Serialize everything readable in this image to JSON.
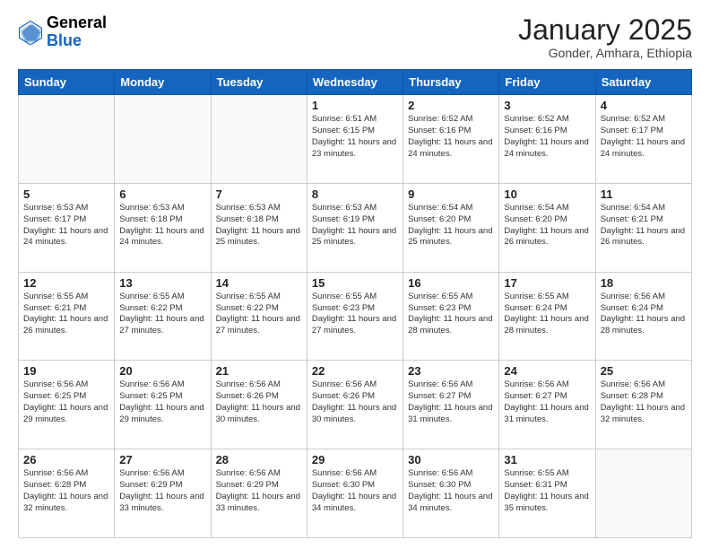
{
  "header": {
    "logo_general": "General",
    "logo_blue": "Blue",
    "month_title": "January 2025",
    "subtitle": "Gonder, Amhara, Ethiopia"
  },
  "weekdays": [
    "Sunday",
    "Monday",
    "Tuesday",
    "Wednesday",
    "Thursday",
    "Friday",
    "Saturday"
  ],
  "weeks": [
    [
      {
        "day": "",
        "info": ""
      },
      {
        "day": "",
        "info": ""
      },
      {
        "day": "",
        "info": ""
      },
      {
        "day": "1",
        "info": "Sunrise: 6:51 AM\nSunset: 6:15 PM\nDaylight: 11 hours and 23 minutes."
      },
      {
        "day": "2",
        "info": "Sunrise: 6:52 AM\nSunset: 6:16 PM\nDaylight: 11 hours and 24 minutes."
      },
      {
        "day": "3",
        "info": "Sunrise: 6:52 AM\nSunset: 6:16 PM\nDaylight: 11 hours and 24 minutes."
      },
      {
        "day": "4",
        "info": "Sunrise: 6:52 AM\nSunset: 6:17 PM\nDaylight: 11 hours and 24 minutes."
      }
    ],
    [
      {
        "day": "5",
        "info": "Sunrise: 6:53 AM\nSunset: 6:17 PM\nDaylight: 11 hours and 24 minutes."
      },
      {
        "day": "6",
        "info": "Sunrise: 6:53 AM\nSunset: 6:18 PM\nDaylight: 11 hours and 24 minutes."
      },
      {
        "day": "7",
        "info": "Sunrise: 6:53 AM\nSunset: 6:18 PM\nDaylight: 11 hours and 25 minutes."
      },
      {
        "day": "8",
        "info": "Sunrise: 6:53 AM\nSunset: 6:19 PM\nDaylight: 11 hours and 25 minutes."
      },
      {
        "day": "9",
        "info": "Sunrise: 6:54 AM\nSunset: 6:20 PM\nDaylight: 11 hours and 25 minutes."
      },
      {
        "day": "10",
        "info": "Sunrise: 6:54 AM\nSunset: 6:20 PM\nDaylight: 11 hours and 26 minutes."
      },
      {
        "day": "11",
        "info": "Sunrise: 6:54 AM\nSunset: 6:21 PM\nDaylight: 11 hours and 26 minutes."
      }
    ],
    [
      {
        "day": "12",
        "info": "Sunrise: 6:55 AM\nSunset: 6:21 PM\nDaylight: 11 hours and 26 minutes."
      },
      {
        "day": "13",
        "info": "Sunrise: 6:55 AM\nSunset: 6:22 PM\nDaylight: 11 hours and 27 minutes."
      },
      {
        "day": "14",
        "info": "Sunrise: 6:55 AM\nSunset: 6:22 PM\nDaylight: 11 hours and 27 minutes."
      },
      {
        "day": "15",
        "info": "Sunrise: 6:55 AM\nSunset: 6:23 PM\nDaylight: 11 hours and 27 minutes."
      },
      {
        "day": "16",
        "info": "Sunrise: 6:55 AM\nSunset: 6:23 PM\nDaylight: 11 hours and 28 minutes."
      },
      {
        "day": "17",
        "info": "Sunrise: 6:55 AM\nSunset: 6:24 PM\nDaylight: 11 hours and 28 minutes."
      },
      {
        "day": "18",
        "info": "Sunrise: 6:56 AM\nSunset: 6:24 PM\nDaylight: 11 hours and 28 minutes."
      }
    ],
    [
      {
        "day": "19",
        "info": "Sunrise: 6:56 AM\nSunset: 6:25 PM\nDaylight: 11 hours and 29 minutes."
      },
      {
        "day": "20",
        "info": "Sunrise: 6:56 AM\nSunset: 6:25 PM\nDaylight: 11 hours and 29 minutes."
      },
      {
        "day": "21",
        "info": "Sunrise: 6:56 AM\nSunset: 6:26 PM\nDaylight: 11 hours and 30 minutes."
      },
      {
        "day": "22",
        "info": "Sunrise: 6:56 AM\nSunset: 6:26 PM\nDaylight: 11 hours and 30 minutes."
      },
      {
        "day": "23",
        "info": "Sunrise: 6:56 AM\nSunset: 6:27 PM\nDaylight: 11 hours and 31 minutes."
      },
      {
        "day": "24",
        "info": "Sunrise: 6:56 AM\nSunset: 6:27 PM\nDaylight: 11 hours and 31 minutes."
      },
      {
        "day": "25",
        "info": "Sunrise: 6:56 AM\nSunset: 6:28 PM\nDaylight: 11 hours and 32 minutes."
      }
    ],
    [
      {
        "day": "26",
        "info": "Sunrise: 6:56 AM\nSunset: 6:28 PM\nDaylight: 11 hours and 32 minutes."
      },
      {
        "day": "27",
        "info": "Sunrise: 6:56 AM\nSunset: 6:29 PM\nDaylight: 11 hours and 33 minutes."
      },
      {
        "day": "28",
        "info": "Sunrise: 6:56 AM\nSunset: 6:29 PM\nDaylight: 11 hours and 33 minutes."
      },
      {
        "day": "29",
        "info": "Sunrise: 6:56 AM\nSunset: 6:30 PM\nDaylight: 11 hours and 34 minutes."
      },
      {
        "day": "30",
        "info": "Sunrise: 6:56 AM\nSunset: 6:30 PM\nDaylight: 11 hours and 34 minutes."
      },
      {
        "day": "31",
        "info": "Sunrise: 6:55 AM\nSunset: 6:31 PM\nDaylight: 11 hours and 35 minutes."
      },
      {
        "day": "",
        "info": ""
      }
    ]
  ]
}
